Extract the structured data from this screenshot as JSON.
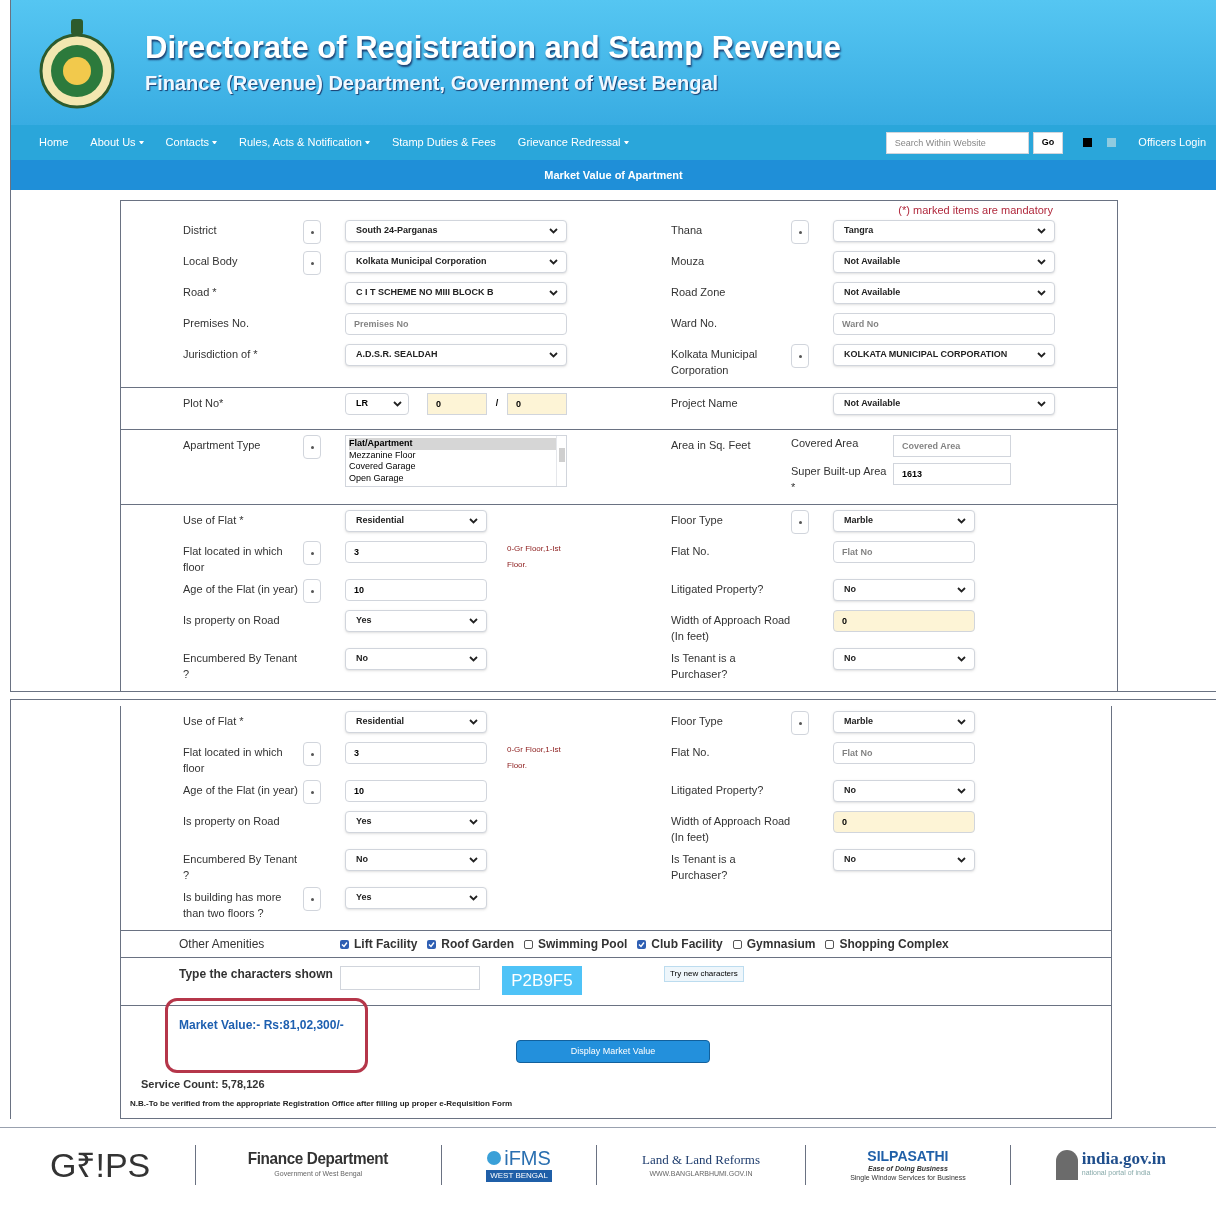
{
  "header": {
    "title": "Directorate of Registration and Stamp Revenue",
    "subtitle": "Finance (Revenue) Department, Government of West Bengal"
  },
  "nav": {
    "items": [
      {
        "label": "Home",
        "has_menu": false
      },
      {
        "label": "About Us",
        "has_menu": true
      },
      {
        "label": "Contacts",
        "has_menu": true
      },
      {
        "label": "Rules, Acts & Notification",
        "has_menu": true
      },
      {
        "label": "Stamp Duties & Fees",
        "has_menu": false
      },
      {
        "label": "Grievance Redressal",
        "has_menu": true
      }
    ],
    "search": {
      "placeholder": "Search Within Website"
    },
    "go_button": "Go",
    "login": "Officers Login"
  },
  "page_title": "Market Value of Apartment",
  "form": {
    "mandatory_note": "(*) marked items are mandatory",
    "sections": [
      {
        "kind": "wide",
        "rows": [
          {
            "left": {
              "label": "District",
              "help": true,
              "kind": "select",
              "value": "South 24-Parganas"
            },
            "right": {
              "label": "Thana",
              "help": true,
              "kind": "select",
              "value": "Tangra"
            }
          },
          {
            "left": {
              "label": "Local Body",
              "help": true,
              "kind": "select",
              "value": "Kolkata Municipal Corporation"
            },
            "right": {
              "label": "Mouza",
              "help": false,
              "kind": "select",
              "value": "Not Available"
            }
          },
          {
            "left": {
              "label": "Road *",
              "help": false,
              "kind": "select",
              "value": "C I T SCHEME NO MIII BLOCK B"
            },
            "right": {
              "label": "Road Zone",
              "help": false,
              "kind": "select",
              "value": "Not Available"
            }
          },
          {
            "left": {
              "label": "Premises No.",
              "help": false,
              "kind": "input",
              "placeholder": "Premises No"
            },
            "right": {
              "label": "Ward No.",
              "help": false,
              "kind": "input",
              "placeholder": "Ward No"
            }
          },
          {
            "left": {
              "label": "Jurisdiction of *",
              "help": false,
              "kind": "select",
              "value": "A.D.S.R. SEALDAH"
            },
            "right": {
              "label": "Kolkata Municipal Corporation",
              "help": true,
              "kind": "select",
              "value": "KOLKATA MUNICIPAL CORPORATION"
            }
          }
        ]
      },
      {
        "kind": "wide",
        "rows": [
          {
            "left": {
              "label": "Plot No*",
              "help": false,
              "kind": "plot",
              "value": "LR",
              "parts": [
                "0",
                "0"
              ],
              "separator": "/"
            },
            "right": {
              "label": "Project Name",
              "help": false,
              "kind": "select",
              "value": "Not Available"
            }
          }
        ]
      },
      {
        "kind": "wide",
        "rows": [
          {
            "left": {
              "label": "Apartment Type",
              "help": true,
              "kind": "listbox",
              "options": [
                {
                  "label": "Flat/Apartment",
                  "selected": true
                },
                {
                  "label": "Mezzanine Floor",
                  "selected": false
                },
                {
                  "label": "Covered Garage",
                  "selected": false
                },
                {
                  "label": "Open Garage",
                  "selected": false
                }
              ]
            },
            "right": {
              "label": "Area in Sq. Feet",
              "help": false,
              "kind": "area",
              "subfields": [
                {
                  "label": "Covered Area",
                  "placeholder": "Covered Area"
                },
                {
                  "label": "Super Built-up Area *",
                  "value": "1613"
                }
              ]
            }
          }
        ]
      },
      {
        "kind": "flat",
        "rows": [
          {
            "left": {
              "label": "Use of Flat *",
              "help": false,
              "kind": "select",
              "value": "Residential"
            },
            "right": {
              "label": "Floor Type",
              "help": true,
              "kind": "select",
              "value": "Marble"
            }
          },
          {
            "left": {
              "label": "Flat located in which floor",
              "help": true,
              "kind": "input",
              "value": "3",
              "note": "0-Gr Floor,1-Ist Floor."
            },
            "right": {
              "label": "Flat No.",
              "help": false,
              "kind": "input",
              "placeholder": "Flat No"
            }
          },
          {
            "left": {
              "label": "Age of the Flat (in year)",
              "help": true,
              "kind": "input",
              "value": "10"
            },
            "right": {
              "label": "Litigated Property?",
              "help": false,
              "kind": "select",
              "value": "No"
            }
          },
          {
            "left": {
              "label": "Is property on Road",
              "help": false,
              "kind": "select",
              "value": "Yes"
            },
            "right": {
              "label": "Width of Approach Road (In feet)",
              "help": false,
              "kind": "input",
              "value": "0",
              "mandatory": true
            }
          },
          {
            "left": {
              "label": "Encumbered By Tenant ?",
              "help": false,
              "kind": "select",
              "value": "No"
            },
            "right": {
              "label": "Is Tenant is a Purchaser?",
              "help": false,
              "kind": "select",
              "value": "No"
            }
          }
        ]
      }
    ]
  },
  "form_2": {
    "sections": [
      {
        "kind": "flat",
        "rows": [
          {
            "left": {
              "label": "Use of Flat *",
              "help": false,
              "kind": "select",
              "value": "Residential"
            },
            "right": {
              "label": "Floor Type",
              "help": true,
              "kind": "select",
              "value": "Marble"
            }
          },
          {
            "left": {
              "label": "Flat located in which floor",
              "help": true,
              "kind": "input",
              "value": "3",
              "note": "0-Gr Floor,1-Ist Floor."
            },
            "right": {
              "label": "Flat No.",
              "help": false,
              "kind": "input",
              "placeholder": "Flat No"
            }
          },
          {
            "left": {
              "label": "Age of the Flat (in year)",
              "help": true,
              "kind": "input",
              "value": "10"
            },
            "right": {
              "label": "Litigated Property?",
              "help": false,
              "kind": "select",
              "value": "No"
            }
          },
          {
            "left": {
              "label": "Is property on Road",
              "help": false,
              "kind": "select",
              "value": "Yes"
            },
            "right": {
              "label": "Width of Approach Road (In feet)",
              "help": false,
              "kind": "input",
              "value": "0",
              "mandatory": true
            }
          },
          {
            "left": {
              "label": "Encumbered By Tenant ?",
              "help": false,
              "kind": "select",
              "value": "No"
            },
            "right": {
              "label": "Is Tenant is a Purchaser?",
              "help": false,
              "kind": "select",
              "value": "No"
            }
          },
          {
            "left": {
              "label": "Is building has more than two floors ?",
              "help": true,
              "kind": "select",
              "value": "Yes"
            }
          }
        ]
      }
    ],
    "amenities": {
      "label": "Other Amenities",
      "items": [
        {
          "label": "Lift Facility",
          "checked": true
        },
        {
          "label": "Roof Garden",
          "checked": true
        },
        {
          "label": "Swimming Pool",
          "checked": false
        },
        {
          "label": "Club Facility",
          "checked": true
        },
        {
          "label": "Gymnasium",
          "checked": false
        },
        {
          "label": "Shopping Complex",
          "checked": false
        }
      ]
    },
    "captcha": {
      "label": "Type the characters shown",
      "code": "P2B9F5",
      "refresh_button": "Try new characters"
    },
    "result": {
      "text": "Market Value:- Rs:81,02,300/-",
      "highlighted": true,
      "button": "Display Market Value"
    },
    "service_count": "Service Count: 5,78,126",
    "note": "N.B.-To be verified from the appropriate Registration Office after filling up proper e-Requisition Form"
  },
  "footer": {
    "logos": [
      {
        "kind": "grips",
        "name": "G₹!PS"
      },
      {
        "kind": "finance",
        "name": "Finance Department",
        "tagline": "Government of West Bengal"
      },
      {
        "kind": "ifms",
        "name": "iFMS",
        "tagline": "WEST BENGAL"
      },
      {
        "kind": "land",
        "name": "Land & Land Reforms",
        "tagline": "WWW.BANGLARBHUMI.GOV.IN"
      },
      {
        "kind": "silpasathi",
        "name": "SILPASATHI",
        "tagline": "Ease of Doing Business",
        "sub": "Single Window Services for Business"
      },
      {
        "kind": "india",
        "name": "india.gov.in",
        "tagline": "national portal of india"
      }
    ]
  }
}
